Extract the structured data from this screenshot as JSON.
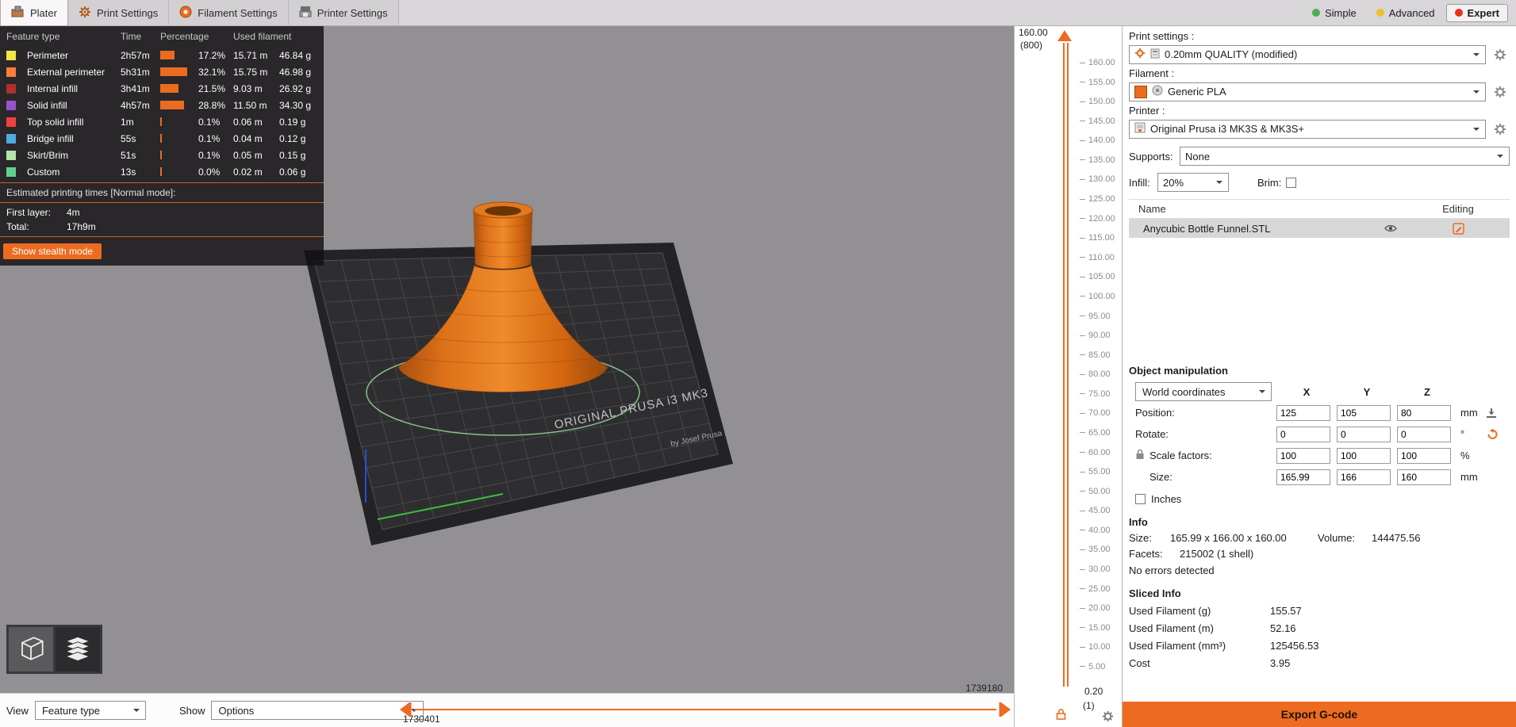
{
  "app": {
    "tabs": [
      {
        "label": "Plater"
      },
      {
        "label": "Print Settings"
      },
      {
        "label": "Filament Settings"
      },
      {
        "label": "Printer Settings"
      }
    ],
    "modes": [
      {
        "label": "Simple",
        "color": "#4caf50"
      },
      {
        "label": "Advanced",
        "color": "#f0c02a"
      },
      {
        "label": "Expert",
        "color": "#e2321b"
      }
    ]
  },
  "legend": {
    "headers": {
      "feature": "Feature type",
      "time": "Time",
      "percentage": "Percentage",
      "used": "Used filament"
    },
    "rows": [
      {
        "label": "Perimeter",
        "color": "#f5e545",
        "time": "2h57m",
        "pct": "17.2%",
        "pct_num": 17.2,
        "meters": "15.71 m",
        "grams": "46.84 g"
      },
      {
        "label": "External perimeter",
        "color": "#ff7d38",
        "time": "5h31m",
        "pct": "32.1%",
        "pct_num": 32.1,
        "meters": "15.75 m",
        "grams": "46.98 g"
      },
      {
        "label": "Internal infill",
        "color": "#b0302a",
        "time": "3h41m",
        "pct": "21.5%",
        "pct_num": 21.5,
        "meters": "9.03 m",
        "grams": "26.92 g"
      },
      {
        "label": "Solid infill",
        "color": "#9654cc",
        "time": "4h57m",
        "pct": "28.8%",
        "pct_num": 28.8,
        "meters": "11.50 m",
        "grams": "34.30 g"
      },
      {
        "label": "Top solid infill",
        "color": "#f04040",
        "time": "1m",
        "pct": "0.1%",
        "pct_num": 0.1,
        "meters": "0.06 m",
        "grams": "0.19 g"
      },
      {
        "label": "Bridge infill",
        "color": "#4daede",
        "time": "55s",
        "pct": "0.1%",
        "pct_num": 0.1,
        "meters": "0.04 m",
        "grams": "0.12 g"
      },
      {
        "label": "Skirt/Brim",
        "color": "#b3e3ab",
        "time": "51s",
        "pct": "0.1%",
        "pct_num": 0.1,
        "meters": "0.05 m",
        "grams": "0.15 g"
      },
      {
        "label": "Custom",
        "color": "#5fd18f",
        "time": "13s",
        "pct": "0.0%",
        "pct_num": 0.0,
        "meters": "0.02 m",
        "grams": "0.06 g"
      }
    ],
    "estimated_title": "Estimated printing times [Normal mode]:",
    "first_layer_label": "First layer:",
    "first_layer_value": "4m",
    "total_label": "Total:",
    "total_value": "17h9m",
    "stealth_button": "Show stealth mode"
  },
  "scene": {
    "bed_text": "ORIGINAL PRUSA i3 MK3",
    "bed_subtext": "by Josef Prusa"
  },
  "layer_slider": {
    "top_value": "160.00",
    "top_index": "(800)",
    "bottom_value": "0.20",
    "bottom_index": "(1)",
    "ticks": [
      "160.00",
      "155.00",
      "150.00",
      "145.00",
      "140.00",
      "135.00",
      "130.00",
      "125.00",
      "120.00",
      "115.00",
      "110.00",
      "105.00",
      "100.00",
      "95.00",
      "90.00",
      "85.00",
      "80.00",
      "75.00",
      "70.00",
      "65.00",
      "60.00",
      "55.00",
      "50.00",
      "45.00",
      "40.00",
      "35.00",
      "30.00",
      "25.00",
      "20.00",
      "15.00",
      "10.00",
      "5.00"
    ]
  },
  "move_slider": {
    "max_label": "1739180",
    "min_label": "1730401"
  },
  "view_bar": {
    "view_label": "View",
    "view_value": "Feature type",
    "show_label": "Show",
    "show_value": "Options"
  },
  "sidebar": {
    "print_settings_label": "Print settings :",
    "print_settings_value": "0.20mm QUALITY (modified)",
    "filament_label": "Filament :",
    "filament_value": "Generic PLA",
    "printer_label": "Printer :",
    "printer_value": "Original Prusa i3 MK3S & MK3S+",
    "supports_label": "Supports:",
    "supports_value": "None",
    "infill_label": "Infill:",
    "infill_value": "20%",
    "brim_label": "Brim:",
    "objects": {
      "name_header": "Name",
      "editing_header": "Editing",
      "rows": [
        {
          "name": "Anycubic Bottle Funnel.STL"
        }
      ]
    },
    "manipulation": {
      "title": "Object manipulation",
      "coords_value": "World coordinates",
      "axis_x": "X",
      "axis_y": "Y",
      "axis_z": "Z",
      "rows": [
        {
          "label": "Position:",
          "x": "125",
          "y": "105",
          "z": "80",
          "unit": "mm"
        },
        {
          "label": "Rotate:",
          "x": "0",
          "y": "0",
          "z": "0",
          "unit": "°"
        },
        {
          "label": "Scale factors:",
          "x": "100",
          "y": "100",
          "z": "100",
          "unit": "%"
        },
        {
          "label": "Size:",
          "x": "165.99",
          "y": "166",
          "z": "160",
          "unit": "mm"
        }
      ],
      "inches_label": "Inches"
    },
    "info": {
      "title": "Info",
      "size_label": "Size:",
      "size_value": "165.99 x 166.00 x 160.00",
      "volume_label": "Volume:",
      "volume_value": "144475.56",
      "facets_label": "Facets:",
      "facets_value": "215002 (1 shell)",
      "errors": "No errors detected"
    },
    "sliced": {
      "title": "Sliced Info",
      "rows": [
        {
          "label": "Used Filament (g)",
          "value": "155.57"
        },
        {
          "label": "Used Filament (m)",
          "value": "52.16"
        },
        {
          "label": "Used Filament (mm³)",
          "value": "125456.53"
        },
        {
          "label": "Cost",
          "value": "3.95"
        }
      ]
    },
    "export_button": "Export G-code"
  },
  "colors": {
    "accent": "#ed6b21",
    "viewport_bg": "#929093",
    "bed": "#2e2e31",
    "model": "#e8751e"
  }
}
